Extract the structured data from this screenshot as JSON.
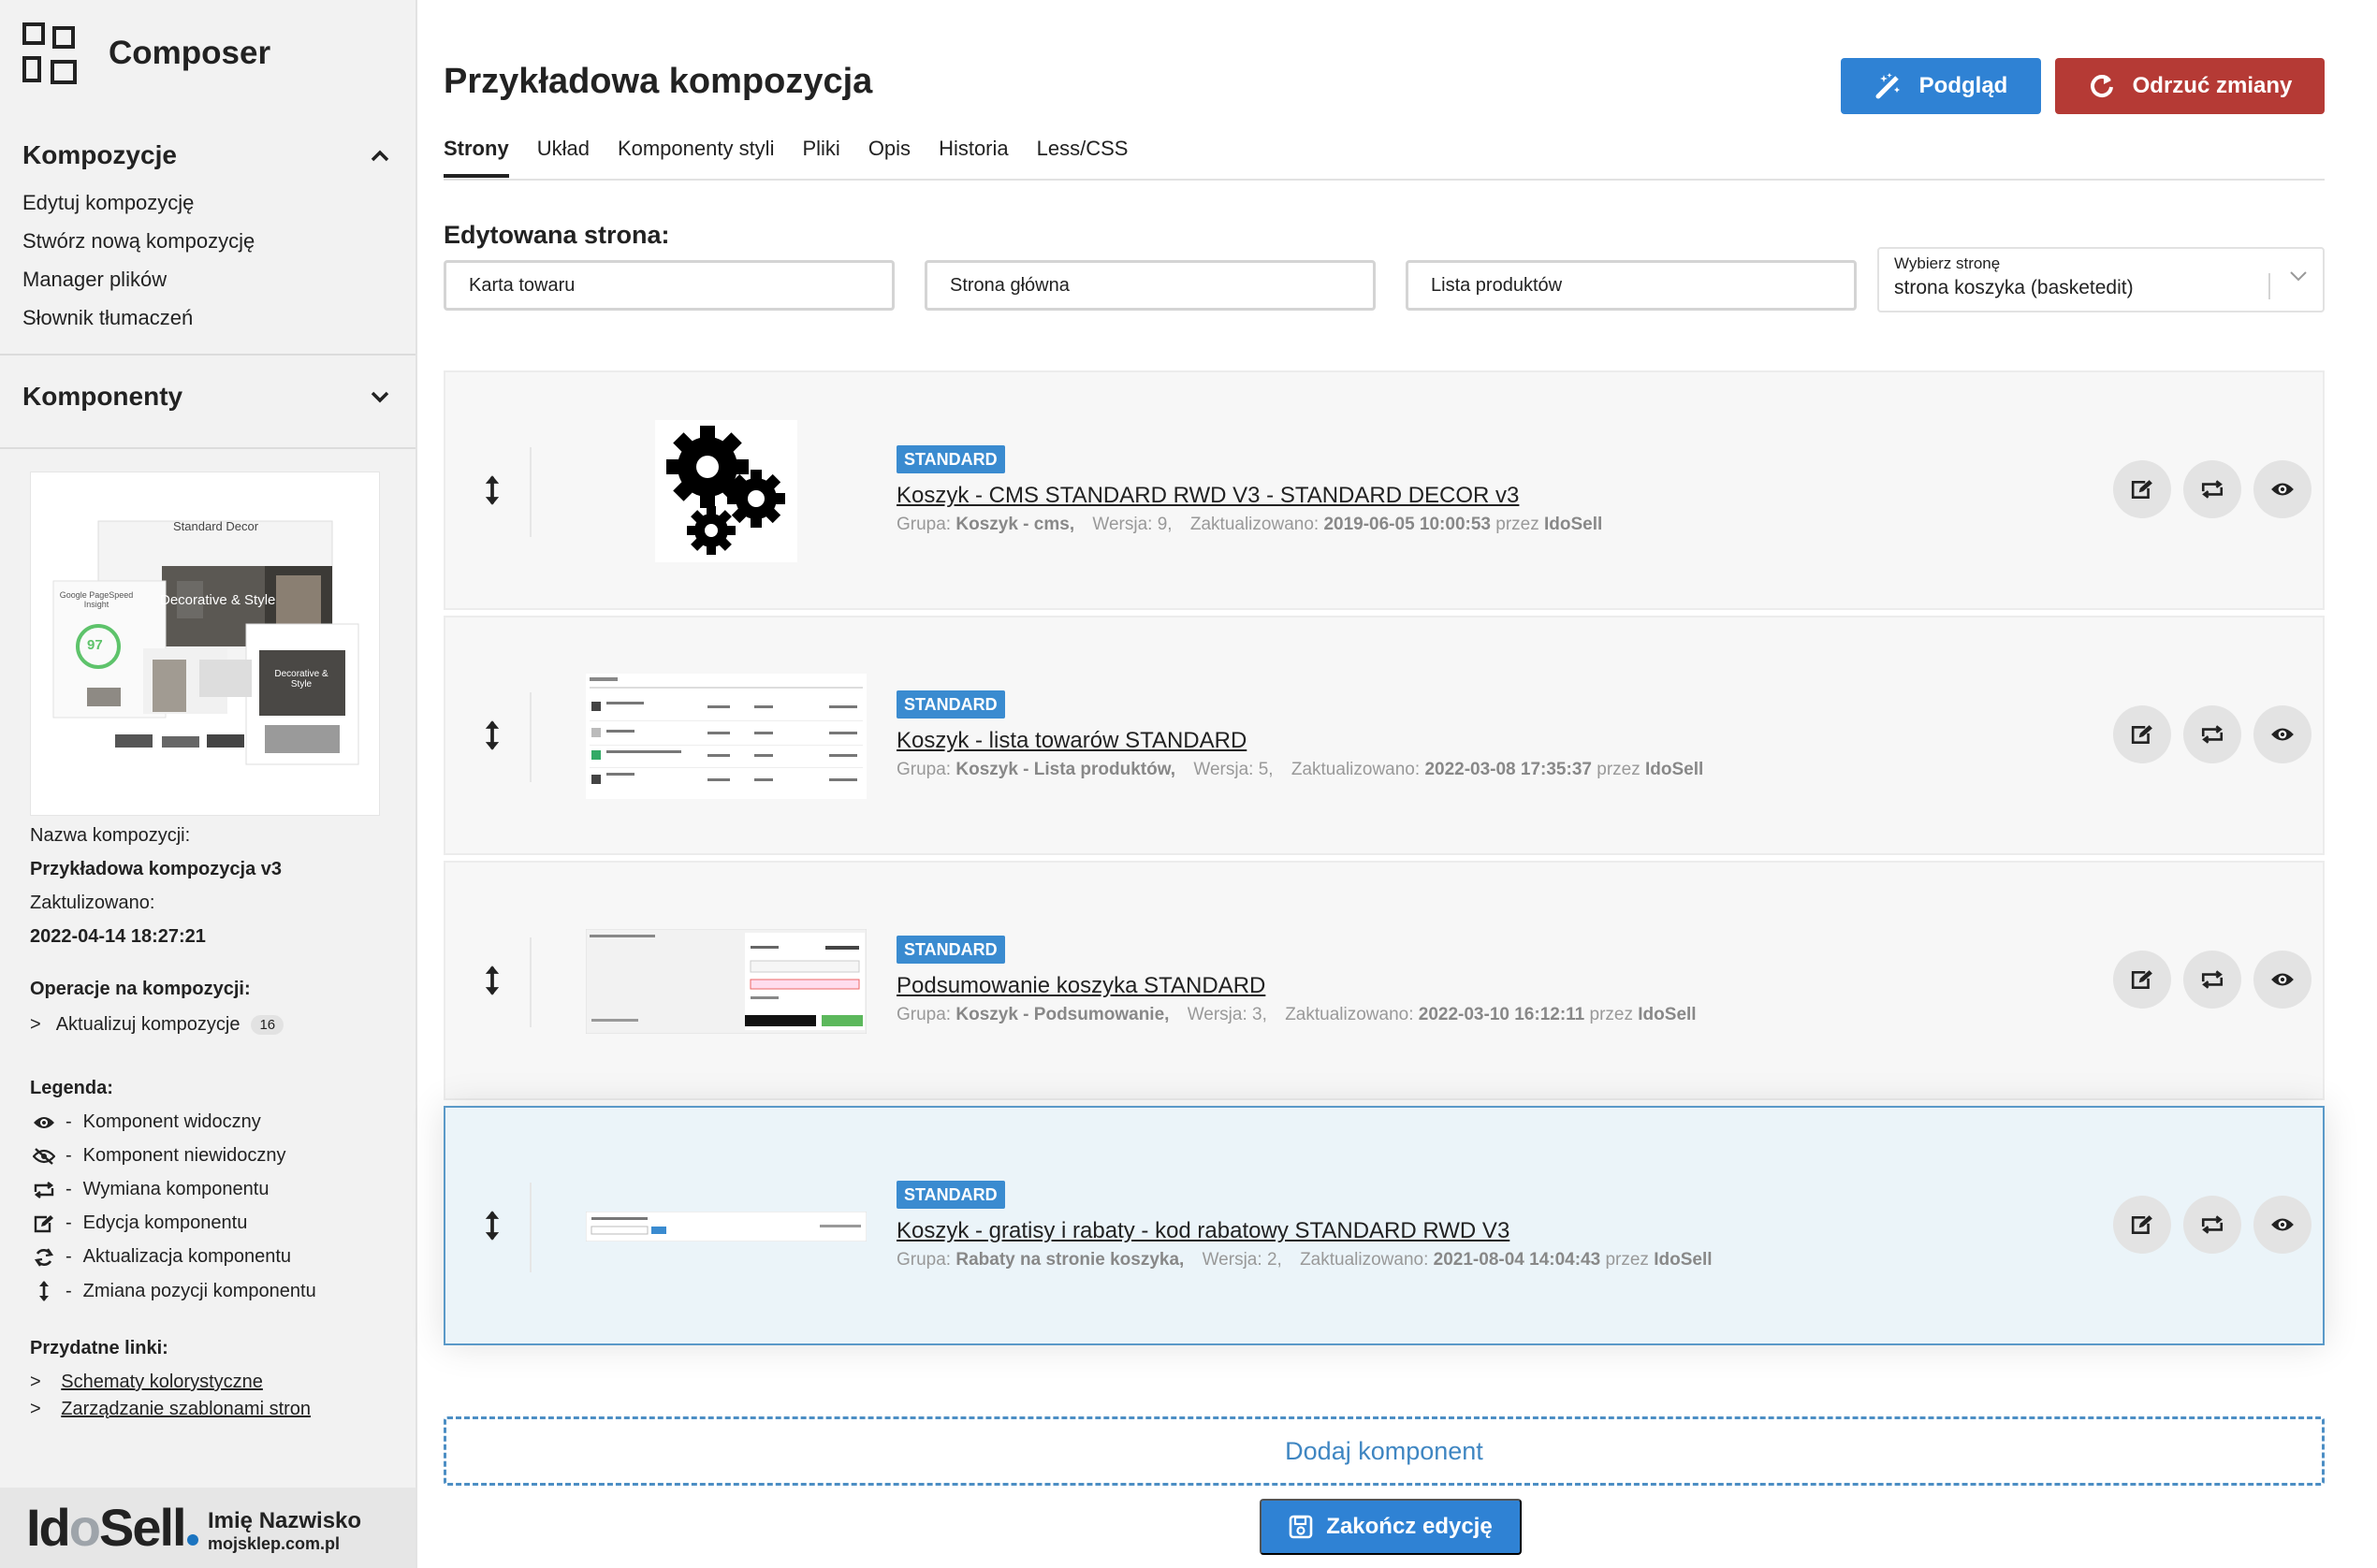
{
  "sidebar": {
    "app_title": "Composer",
    "sections": {
      "compositions": {
        "title": "Kompozycje",
        "items": [
          "Edytuj kompozycję",
          "Stwórz nową kompozycję",
          "Manager plików",
          "Słownik tłumaczeń"
        ]
      },
      "components": {
        "title": "Komponenty"
      }
    },
    "preview": {
      "thumb_title": "Standard Decor",
      "thumb_banner": "Decorative & Style",
      "thumb_side": "Decorative & Style",
      "thumb_score_label": "Google PageSpeed Insight",
      "thumb_score": "97"
    },
    "info": {
      "name_label": "Nazwa kompozycji:",
      "name_value": "Przykładowa kompozycja v3",
      "updated_label": "Zaktulizowano:",
      "updated_value": "2022-04-14 18:27:21",
      "ops_label": "Operacje na kompozycji:",
      "op_prefix": ">",
      "op_update": "Aktualizuj kompozycje",
      "op_count": "16"
    },
    "legend": {
      "title": "Legenda:",
      "dash": "-",
      "items": [
        {
          "icon": "eye-icon",
          "label": "Komponent widoczny"
        },
        {
          "icon": "eye-slash-icon",
          "label": "Komponent niewidoczny"
        },
        {
          "icon": "swap-icon",
          "label": "Wymiana komponentu"
        },
        {
          "icon": "edit-icon",
          "label": "Edycja komponentu"
        },
        {
          "icon": "refresh-icon",
          "label": "Aktualizacja komponentu"
        },
        {
          "icon": "move-icon",
          "label": "Zmiana pozycji komponentu"
        }
      ]
    },
    "links": {
      "title": "Przydatne linki:",
      "prefix": ">",
      "items": [
        "Schematy kolorystyczne",
        "Zarządzanie szablonami stron"
      ]
    },
    "user": {
      "logo_a": "Id",
      "logo_b": "o",
      "logo_c": "Sell",
      "name": "Imię Nazwisko",
      "shop": "mojsklep.com.pl"
    }
  },
  "header": {
    "title": "Przykładowa kompozycja",
    "preview_button": "Podgląd",
    "discard_button": "Odrzuć zmiany"
  },
  "tabs": [
    "Strony",
    "Układ",
    "Komponenty styli",
    "Pliki",
    "Opis",
    "Historia",
    "Less/CSS"
  ],
  "edited_page": {
    "label": "Edytowana strona:",
    "pages": [
      "Karta towaru",
      "Strona główna",
      "Lista produktów"
    ],
    "select_label": "Wybierz stronę",
    "select_value": "strona koszyka (basketedit)"
  },
  "meta_labels": {
    "group": "Grupa:",
    "version": "Wersja:",
    "updated": "Zaktualizowano:",
    "by": "przez"
  },
  "components": [
    {
      "badge": "STANDARD",
      "name": "Koszyk - CMS STANDARD RWD V3 - STANDARD DECOR v3",
      "group": "Koszyk - cms,",
      "version": "9,",
      "updated": "2019-06-05 10:00:53",
      "author": "IdoSell",
      "selected": false
    },
    {
      "badge": "STANDARD",
      "name": "Koszyk - lista towarów STANDARD",
      "group": "Koszyk - Lista produktów,",
      "version": "5,",
      "updated": "2022-03-08 17:35:37",
      "author": "IdoSell",
      "selected": false
    },
    {
      "badge": "STANDARD",
      "name": "Podsumowanie koszyka STANDARD",
      "group": "Koszyk - Podsumowanie,",
      "version": "3,",
      "updated": "2022-03-10 16:12:11",
      "author": "IdoSell",
      "selected": false
    },
    {
      "badge": "STANDARD",
      "name": "Koszyk - gratisy i rabaty - kod rabatowy STANDARD RWD V3",
      "group": "Rabaty na stronie koszyka,",
      "version": "2,",
      "updated": "2021-08-04 14:04:43",
      "author": "IdoSell",
      "selected": true
    }
  ],
  "footer": {
    "add_component": "Dodaj komponent",
    "finish_edit": "Zakończ edycję"
  },
  "colors": {
    "primary": "#2f82d4",
    "danger": "#b53a35",
    "badge": "#3a8bd0",
    "selected_row": "#ebf4f9"
  }
}
